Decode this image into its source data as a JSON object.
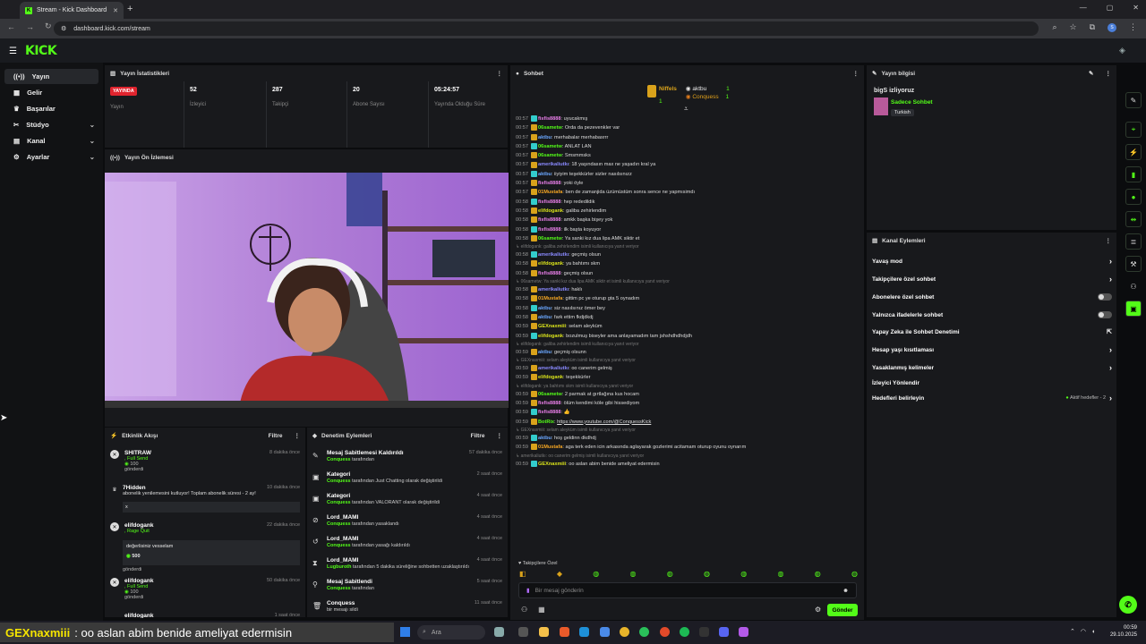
{
  "browser": {
    "tab_title": "Stream - Kick Dashboard",
    "url": "dashboard.kick.com/stream",
    "profile_initial": "S"
  },
  "header": {
    "logo": "KICK"
  },
  "sidebar": {
    "items": [
      {
        "label": "Yayın",
        "icon": "broadcast-icon",
        "active": true
      },
      {
        "label": "Gelir",
        "icon": "revenue-icon"
      },
      {
        "label": "Başarılar",
        "icon": "trophy-icon"
      },
      {
        "label": "Stüdyo",
        "icon": "studio-icon",
        "expandable": true
      },
      {
        "label": "Kanal",
        "icon": "channel-icon",
        "expandable": true
      },
      {
        "label": "Ayarlar",
        "icon": "gear-icon",
        "expandable": true
      }
    ]
  },
  "stats": {
    "title": "Yayın İstatistikleri",
    "live_badge": "YAYINDA",
    "live_label": "Yayın",
    "viewers": {
      "value": "52",
      "label": "İzleyici"
    },
    "followers": {
      "value": "287",
      "label": "Takipçi"
    },
    "subs": {
      "value": "20",
      "label": "Abone Sayısı"
    },
    "uptime": {
      "value": "05:24:57",
      "label": "Yayında Olduğu Süre"
    }
  },
  "preview": {
    "title": "Yayın Ön İzlemesi"
  },
  "activity": {
    "title": "Etkinlik Akışı",
    "filter": "Filtre",
    "items": [
      {
        "name": "SHITRAW",
        "action": ", Full Send",
        "amount": "100",
        "note": "gönderdi",
        "time": "8 dakika önce"
      },
      {
        "name": "7Hidden",
        "action": "abonelik yenilemesini kutluyor! Toplam abonelik süresi - 2 ay!",
        "amount": "x",
        "note": "",
        "time": "10 dakika önce"
      },
      {
        "name": "elifdogank",
        "action": ", Rage Quit",
        "amount": "500",
        "note": "gönderdi",
        "message": "değerlisiniz vesselam",
        "time": "22 dakika önce"
      },
      {
        "name": "elifdogank",
        "action": ", Full Send",
        "amount": "100",
        "note": "gönderdi",
        "time": "50 dakika önce"
      },
      {
        "name": "elifdogank",
        "action": "",
        "amount": "",
        "note": "",
        "time": "1 saat önce"
      }
    ]
  },
  "events": {
    "title": "Denetim Eylemleri",
    "filter": "Filtre",
    "items": [
      {
        "title": "Mesaj Sabitlemesi Kaldırıldı",
        "who": "Conquess",
        "rest": " tarafından",
        "time": "57 dakika önce"
      },
      {
        "title": "Kategori",
        "who": "Conquess",
        "rest": " tarafından Just Chatting olarak değiştirildi",
        "time": "2 saat önce"
      },
      {
        "title": "Kategori",
        "who": "Conquess",
        "rest": " tarafından VALORANT olarak değiştirildi",
        "time": "4 saat önce"
      },
      {
        "title": "Lord_MAMI",
        "who": "Conquess",
        "rest": " tarafından yasaklandı",
        "time": "4 saat önce"
      },
      {
        "title": "Lord_MAMI",
        "who": "Conquess",
        "rest": " tarafından yasağı kaldırıldı",
        "time": "4 saat önce"
      },
      {
        "title": "Lord_MAMI",
        "who": "Lugburoth",
        "rest": " tarafından 5 dakika süreliğine sohbetten uzaklaştırıldı",
        "time": "4 saat önce"
      },
      {
        "title": "Mesaj Sabitlendi",
        "who": "Conquess",
        "rest": " tarafından",
        "time": "5 saat önce"
      },
      {
        "title": "Conquess",
        "who": "",
        "rest": "bir mesajı sildi",
        "time": "11 saat önce"
      }
    ]
  },
  "chat": {
    "title": "Sohbet",
    "top": [
      {
        "name": "Niffels",
        "count": "1"
      },
      {
        "name": "aktbu",
        "count": "1"
      },
      {
        "name": "Conquess",
        "count": "1"
      }
    ],
    "messages": [
      {
        "t": "00:57",
        "u": "fisfis8888",
        "c": "#e87ee8",
        "m": "uyucakmış"
      },
      {
        "t": "00:57",
        "u": "06sametw",
        "c": "#53fc18",
        "m": "Orda da pezevenkler var"
      },
      {
        "t": "00:57",
        "u": "aktbu",
        "c": "#6aa7ff",
        "m": "merhabalar merhabasrrr"
      },
      {
        "t": "00:57",
        "u": "06sametw",
        "c": "#53fc18",
        "m": "ANLAT LAN"
      },
      {
        "t": "00:57",
        "u": "06sametw",
        "c": "#53fc18",
        "m": "Smsmmsks"
      },
      {
        "t": "00:57",
        "u": "amerikaliutkı",
        "c": "#8a8aff",
        "m": "18 yaşındasın max ne yaşadın kral ya"
      },
      {
        "t": "00:57",
        "u": "aktbu",
        "c": "#6aa7ff",
        "m": "iiyiyim teşekkürler sizler nasılsınızz"
      },
      {
        "t": "00:57",
        "u": "fisfis8888",
        "c": "#e87ee8",
        "m": "yoki öyle"
      },
      {
        "t": "00:57",
        "u": "01Mustafa",
        "c": "#f5a623",
        "m": "ben de zamanjida üzümüstüm sonra sence ne yapmısimdı"
      },
      {
        "t": "00:58",
        "u": "fisfis8888",
        "c": "#e87ee8",
        "m": "hep rededildik"
      },
      {
        "t": "00:58",
        "u": "elifdogank",
        "c": "#d9e21b",
        "m": "galiba zehirlendim"
      },
      {
        "t": "00:58",
        "u": "fisfis8888",
        "c": "#e87ee8",
        "m": "amkk başka bişey yok"
      },
      {
        "t": "00:58",
        "u": "fisfis8888",
        "c": "#e87ee8",
        "m": "ilk başta koyuyor"
      },
      {
        "t": "00:58",
        "u": "06sametw",
        "c": "#53fc18",
        "m": "Ya sanki kız dua lipa AMK siktir et"
      },
      {
        "reply": "elifdogank: galiba zehirlendim isimli kullanıcıya yanıt veriyor"
      },
      {
        "t": "00:58",
        "u": "amerikaliutkı",
        "c": "#8a8aff",
        "m": "geçmiş olsun"
      },
      {
        "t": "00:58",
        "u": "elifdogank",
        "c": "#d9e21b",
        "m": "ya bahtımı skm"
      },
      {
        "t": "00:58",
        "u": "fisfis8888",
        "c": "#e87ee8",
        "m": "geçmiş olsun"
      },
      {
        "reply": "06sametw: Ya sanki kız dua lipa AMK siktir et isimli kullanıcıya yanıt veriyor"
      },
      {
        "t": "00:58",
        "u": "amerikaliutkı",
        "c": "#8a8aff",
        "m": "haklı"
      },
      {
        "t": "00:58",
        "u": "01Mustafa",
        "c": "#f5a623",
        "m": "gittim pc ye oturup gta 5 oynadım"
      },
      {
        "t": "00:58",
        "u": "aktbu",
        "c": "#6aa7ff",
        "m": "siz nasılsınız ömer bey"
      },
      {
        "t": "00:58",
        "u": "aktbu",
        "c": "#6aa7ff",
        "m": "fark ettim fkdjdkdj"
      },
      {
        "t": "00:59",
        "u": "GEXnaxmiii",
        "c": "#d9e21b",
        "m": "selam aleyküm"
      },
      {
        "t": "00:59",
        "u": "elifdogank",
        "c": "#d9e21b",
        "m": "bozulmuş biseyler ama anlayamadım tam jshshdhdhdjdh"
      },
      {
        "reply": "elifdogank: galiba zehirlendim isimli kullanıcıya yanıt veriyor"
      },
      {
        "t": "00:59",
        "u": "aktbu",
        "c": "#6aa7ff",
        "m": "geçmiş olsunn"
      },
      {
        "reply": "GEXnaxmiii: selam aleyküm isimli kullanıcıya yanıt veriyor"
      },
      {
        "t": "00:59",
        "u": "amerikaliutkı",
        "c": "#8a8aff",
        "m": "oo canerim gelmiş"
      },
      {
        "t": "00:59",
        "u": "elifdogank",
        "c": "#d9e21b",
        "m": "teşekkürler"
      },
      {
        "reply": "elifdogank: ya bahtımı skm isimli kullanıcıya yanıt veriyor"
      },
      {
        "t": "00:59",
        "u": "06sametw",
        "c": "#53fc18",
        "m": "2 parmak at gırtlağına kus hocam"
      },
      {
        "t": "00:59",
        "u": "fisfis8888",
        "c": "#e87ee8",
        "m": "ölüm kendimi köle gibi hissediyom"
      },
      {
        "t": "00:59",
        "u": "fisfis8888",
        "c": "#e87ee8",
        "m": "👍"
      },
      {
        "t": "00:59",
        "u": "BotRix",
        "c": "#53fc18",
        "m": "https://www.youtube.com/@ConquessKick"
      },
      {
        "reply": "GEXnaxmiii: selam aleyküm isimli kullanıcıya yanıt veriyor"
      },
      {
        "t": "00:59",
        "u": "aktbu",
        "c": "#6aa7ff",
        "m": "hoş geldinn dkdhdj"
      },
      {
        "t": "00:59",
        "u": "01Mustafa",
        "c": "#f5a623",
        "m": "aga terk eden icin arkasında aglayarak gozlerimi acitamam oturup oyunu oynarım"
      },
      {
        "reply": "amerikaliutkı: oo canerim gelmiş isimli kullanıcıya yanıt veriyor"
      },
      {
        "t": "00:59",
        "u": "GEXnaxmiii",
        "c": "#d9e21b",
        "m": "oo aslan abim benide ameliyat edermisin"
      }
    ],
    "followers_only": "Takipçilere Özel",
    "input_placeholder": "Bir mesaj gönderin",
    "send": "Gönder"
  },
  "stream_info": {
    "title": "Yayın bilgisi",
    "watching": "bigS izliyoruz",
    "category": "Sadece Sohbet",
    "language": "Turkish"
  },
  "channel_actions": {
    "title": "Kanal Eylemleri",
    "items": [
      {
        "label": "Yavaş mod",
        "kind": "arrow"
      },
      {
        "label": "Takipçilere özel sohbet",
        "kind": "arrow"
      },
      {
        "label": "Abonelere özel sohbet",
        "kind": "toggle"
      },
      {
        "label": "Yalnızca ifadelerle sohbet",
        "kind": "toggle"
      },
      {
        "label": "Yapay Zeka ile Sohbet Denetimi",
        "kind": "ext"
      },
      {
        "label": "Hesap yaşı kısıtlaması",
        "kind": "arrow"
      },
      {
        "label": "Yasaklanmış kelimeler",
        "kind": "arrow"
      },
      {
        "label": "İzleyici Yönlendir",
        "kind": "none"
      },
      {
        "label": "Hedefleri belirleyin",
        "kind": "arrow",
        "badge": "Aktif hedefler - 2"
      }
    ]
  },
  "taskbar": {
    "overlay_user": "GEXnaxmiii",
    "overlay_msg": ": oo aslan abim benide ameliyat edermisin",
    "search": "Ara",
    "time": "00:59",
    "date": "29.10.2025"
  }
}
